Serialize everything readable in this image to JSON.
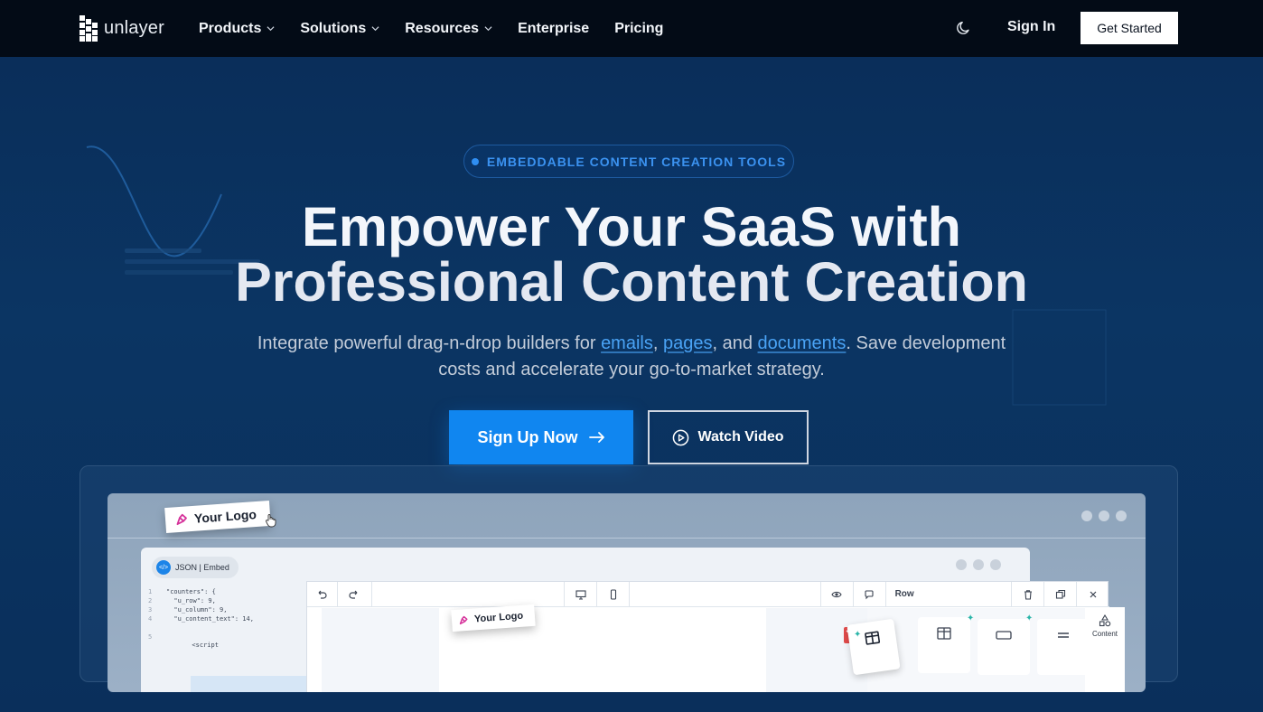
{
  "nav": {
    "logo_text": "unlayer",
    "links": [
      {
        "label": "Products",
        "dropdown": true
      },
      {
        "label": "Solutions",
        "dropdown": true
      },
      {
        "label": "Resources",
        "dropdown": true
      },
      {
        "label": "Enterprise",
        "dropdown": false
      },
      {
        "label": "Pricing",
        "dropdown": false
      }
    ],
    "theme_icon": "moon-icon",
    "sign_in": "Sign In",
    "get_started": "Get Started"
  },
  "hero": {
    "badge": "EMBEDDABLE CONTENT CREATION TOOLS",
    "headline_line1": "Empower Your SaaS with",
    "headline_line2": "Professional Content Creation",
    "sub_before": "Integrate powerful drag-n-drop builders for ",
    "link_emails": "emails",
    "sep1": ", ",
    "link_pages": "pages",
    "sep2": ", and ",
    "link_documents": "documents",
    "sub_after": ". Save development costs and accelerate your go-to-market strategy.",
    "signup_label": "Sign Up Now",
    "watch_label": "Watch Video"
  },
  "preview": {
    "logo_label": "Your Logo",
    "json_tab": "JSON | Embed",
    "code_lines": [
      "\"counters\": {",
      "  \"u_row\": 9,",
      "  \"u_column\": 9,",
      "  \"u_content_text\": 14,",
      "",
      "  <script"
    ],
    "toolbar_row_label": "Row",
    "inner_logo_label": "Your Logo",
    "tile_content": "Content"
  },
  "colors": {
    "nav_bg": "#030b16",
    "hero_bg": "#0b3563",
    "accent": "#1086f0",
    "link": "#4aa3f5"
  }
}
